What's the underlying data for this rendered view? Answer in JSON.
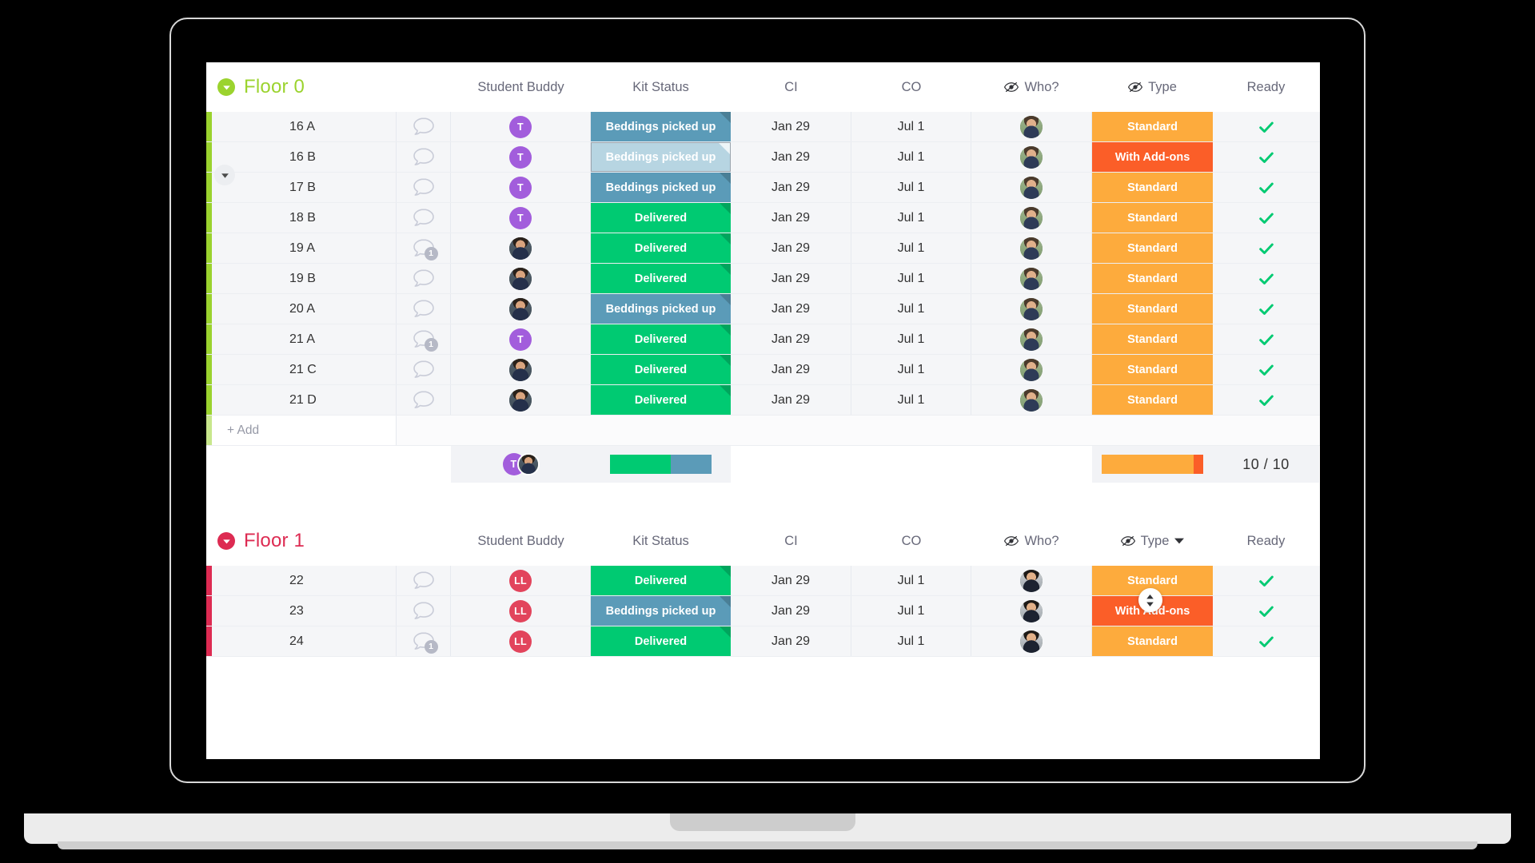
{
  "columns": {
    "student_buddy": "Student Buddy",
    "kit_status": "Kit Status",
    "ci": "CI",
    "co": "CO",
    "who": "Who?",
    "type": "Type",
    "ready": "Ready"
  },
  "add_row_label": "+ Add",
  "colors": {
    "floor0_accent": "#9bd32e",
    "floor1_accent": "#dd2b52",
    "status_delivered": "#00ca72",
    "status_beddings": "#5b9bb8",
    "status_beddings_selected": "#b7d5e2",
    "type_standard": "#fdab3d",
    "type_addons": "#fb5e28",
    "check_green": "#00ca72",
    "row_bg": "#f5f6f8",
    "header_text": "#676879"
  },
  "groups": [
    {
      "name": "Floor 0",
      "accent": "#9bd32e",
      "rows": [
        {
          "name": "16 A",
          "chat_badge": null,
          "buddy": "T",
          "buddy_type": "initial",
          "buddy_color": "#a25ddc",
          "kit_status": "Beddings picked up",
          "kit_color": "#5b9bb8",
          "selected": false,
          "ci": "Jan 29",
          "co": "Jul 1",
          "who_type": "photo",
          "who_variant": "light",
          "type": "Standard",
          "type_color": "#fdab3d",
          "ready": true
        },
        {
          "name": "16 B",
          "chat_badge": null,
          "buddy": "T",
          "buddy_type": "initial",
          "buddy_color": "#a25ddc",
          "kit_status": "Beddings picked up",
          "kit_color": "#5b9bb8",
          "selected": true,
          "ci": "Jan 29",
          "co": "Jul 1",
          "who_type": "photo",
          "who_variant": "light",
          "type": "With Add-ons",
          "type_color": "#fb5e28",
          "ready": true
        },
        {
          "name": "17 B",
          "chat_badge": null,
          "buddy": "T",
          "buddy_type": "initial",
          "buddy_color": "#a25ddc",
          "kit_status": "Beddings picked up",
          "kit_color": "#5b9bb8",
          "selected": false,
          "ci": "Jan 29",
          "co": "Jul 1",
          "who_type": "photo",
          "who_variant": "light",
          "type": "Standard",
          "type_color": "#fdab3d",
          "ready": true
        },
        {
          "name": "18 B",
          "chat_badge": null,
          "buddy": "T",
          "buddy_type": "initial",
          "buddy_color": "#a25ddc",
          "kit_status": "Delivered",
          "kit_color": "#00ca72",
          "selected": false,
          "ci": "Jan 29",
          "co": "Jul 1",
          "who_type": "photo",
          "who_variant": "light",
          "type": "Standard",
          "type_color": "#fdab3d",
          "ready": true
        },
        {
          "name": "19 A",
          "chat_badge": "1",
          "buddy": "",
          "buddy_type": "photo",
          "buddy_color": "#3b4a66",
          "kit_status": "Delivered",
          "kit_color": "#00ca72",
          "selected": false,
          "ci": "Jan 29",
          "co": "Jul 1",
          "who_type": "photo",
          "who_variant": "light",
          "type": "Standard",
          "type_color": "#fdab3d",
          "ready": true
        },
        {
          "name": "19 B",
          "chat_badge": null,
          "buddy": "",
          "buddy_type": "photo",
          "buddy_color": "#3b4a66",
          "kit_status": "Delivered",
          "kit_color": "#00ca72",
          "selected": false,
          "ci": "Jan 29",
          "co": "Jul 1",
          "who_type": "photo",
          "who_variant": "light",
          "type": "Standard",
          "type_color": "#fdab3d",
          "ready": true
        },
        {
          "name": "20 A",
          "chat_badge": null,
          "buddy": "",
          "buddy_type": "photo",
          "buddy_color": "#3b4a66",
          "kit_status": "Beddings picked up",
          "kit_color": "#5b9bb8",
          "selected": false,
          "ci": "Jan 29",
          "co": "Jul 1",
          "who_type": "photo",
          "who_variant": "light",
          "type": "Standard",
          "type_color": "#fdab3d",
          "ready": true
        },
        {
          "name": "21 A",
          "chat_badge": "1",
          "buddy": "T",
          "buddy_type": "initial",
          "buddy_color": "#a25ddc",
          "kit_status": "Delivered",
          "kit_color": "#00ca72",
          "selected": false,
          "ci": "Jan 29",
          "co": "Jul 1",
          "who_type": "photo",
          "who_variant": "light",
          "type": "Standard",
          "type_color": "#fdab3d",
          "ready": true
        },
        {
          "name": "21 C",
          "chat_badge": null,
          "buddy": "",
          "buddy_type": "photo",
          "buddy_color": "#3b4a66",
          "kit_status": "Delivered",
          "kit_color": "#00ca72",
          "selected": false,
          "ci": "Jan 29",
          "co": "Jul 1",
          "who_type": "photo",
          "who_variant": "light",
          "type": "Standard",
          "type_color": "#fdab3d",
          "ready": true
        },
        {
          "name": "21 D",
          "chat_badge": null,
          "buddy": "",
          "buddy_type": "photo",
          "buddy_color": "#3b4a66",
          "kit_status": "Delivered",
          "kit_color": "#00ca72",
          "selected": false,
          "ci": "Jan 29",
          "co": "Jul 1",
          "who_type": "photo",
          "who_variant": "light",
          "type": "Standard",
          "type_color": "#fdab3d",
          "ready": true
        }
      ],
      "summary": {
        "buddy_avatars": [
          {
            "label": "T",
            "type": "initial",
            "color": "#a25ddc"
          },
          {
            "label": "",
            "type": "photo",
            "color": "#3b4a66"
          }
        ],
        "kit_bar": [
          {
            "color": "#00ca72",
            "pct": 60
          },
          {
            "color": "#5b9bb8",
            "pct": 40
          }
        ],
        "type_bar": [
          {
            "color": "#fdab3d",
            "pct": 90
          },
          {
            "color": "#fb5e28",
            "pct": 10
          }
        ],
        "ready_count": "10 / 10"
      }
    },
    {
      "name": "Floor 1",
      "accent": "#dd2b52",
      "type_has_caret": true,
      "rows": [
        {
          "name": "22",
          "chat_badge": null,
          "buddy": "LL",
          "buddy_type": "initial",
          "buddy_color": "#e2445c",
          "kit_status": "Delivered",
          "kit_color": "#00ca72",
          "selected": false,
          "ci": "Jan 29",
          "co": "Jul 1",
          "who_type": "photo",
          "who_variant": "grey",
          "type": "Standard",
          "type_color": "#fdab3d",
          "ready": true
        },
        {
          "name": "23",
          "chat_badge": null,
          "buddy": "LL",
          "buddy_type": "initial",
          "buddy_color": "#e2445c",
          "kit_status": "Beddings picked up",
          "kit_color": "#5b9bb8",
          "selected": false,
          "ci": "Jan 29",
          "co": "Jul 1",
          "who_type": "photo",
          "who_variant": "grey",
          "type": "With Add-ons",
          "type_color": "#fb5e28",
          "ready": true
        },
        {
          "name": "24",
          "chat_badge": "1",
          "buddy": "LL",
          "buddy_type": "initial",
          "buddy_color": "#e2445c",
          "kit_status": "Delivered",
          "kit_color": "#00ca72",
          "selected": false,
          "ci": "Jan 29",
          "co": "Jul 1",
          "who_type": "photo",
          "who_variant": "grey",
          "type": "Standard",
          "type_color": "#fdab3d",
          "ready": true
        }
      ]
    }
  ]
}
